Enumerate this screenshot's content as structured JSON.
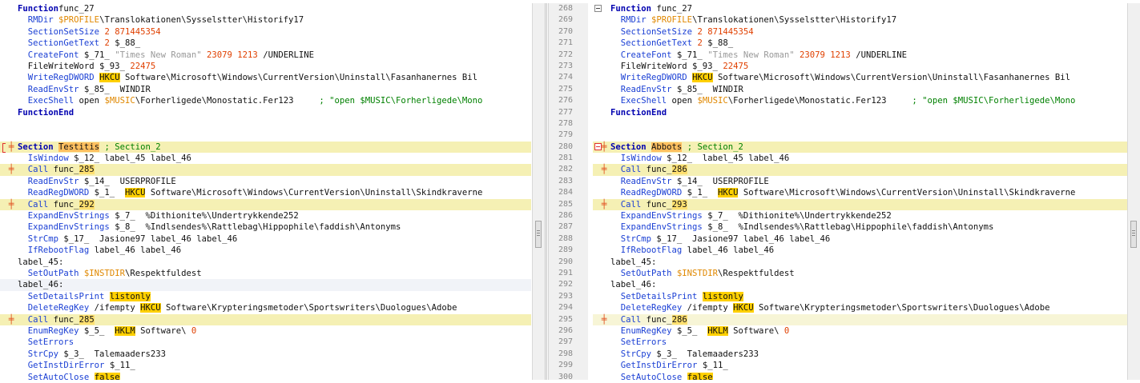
{
  "left_lines": [
    [
      [
        "kw",
        "Function"
      ],
      [
        "",
        "func_27"
      ]
    ],
    [
      [
        "fn",
        "  RMDir"
      ],
      [
        "var",
        " $PROFILE"
      ],
      [
        "",
        "\\Translokationen\\Sysselstter\\Historify17"
      ]
    ],
    [
      [
        "fn",
        "  SectionSetSize"
      ],
      [
        "num",
        " 2 871445354"
      ]
    ],
    [
      [
        "fn",
        "  SectionGetText"
      ],
      [
        "num",
        " 2"
      ],
      [
        "",
        " $_88_"
      ]
    ],
    [
      [
        "fn",
        "  CreateFont"
      ],
      [
        "",
        " $_71_ "
      ],
      [
        "str",
        "\"Times New Roman\""
      ],
      [
        "num",
        " 23079 1213"
      ],
      [
        "",
        " /UNDERLINE"
      ]
    ],
    [
      [
        "",
        "  FileWriteWord $_93_ "
      ],
      [
        "num",
        "22475"
      ]
    ],
    [
      [
        "fn",
        "  WriteRegDWORD"
      ],
      [
        "",
        " "
      ],
      [
        "hi",
        "HKCU"
      ],
      [
        "",
        " Software\\Microsoft\\Windows\\CurrentVersion\\Uninstall\\Fasanhanernes Bil"
      ]
    ],
    [
      [
        "fn",
        "  ReadEnvStr"
      ],
      [
        "",
        " $_85_  WINDIR"
      ]
    ],
    [
      [
        "fn",
        "  ExecShell"
      ],
      [
        "",
        " open "
      ],
      [
        "var",
        "$MUSIC"
      ],
      [
        "",
        "\\Forherligede\\Monostatic.Fer123     "
      ],
      [
        "cmt",
        "; \"open $MUSIC\\Forherligede\\Mono"
      ]
    ],
    [
      [
        "kw",
        "FunctionEnd"
      ]
    ],
    [],
    [],
    [
      [
        "kw",
        "Section"
      ],
      [
        "",
        " "
      ],
      [
        "hd",
        "Testitis"
      ],
      [
        "cmt",
        " ; Section_2"
      ]
    ],
    [
      [
        "fn",
        "  IsWindow"
      ],
      [
        "",
        " $_12_ label_45 label_46"
      ]
    ],
    [
      [
        "fn",
        "  Call"
      ],
      [
        "",
        " func_"
      ],
      [
        "hc",
        "285"
      ]
    ],
    [
      [
        "fn",
        "  ReadEnvStr"
      ],
      [
        "",
        " $_14_  USERPROFILE"
      ]
    ],
    [
      [
        "fn",
        "  ReadRegDWORD"
      ],
      [
        "",
        " $_1_  "
      ],
      [
        "hi",
        "HKCU"
      ],
      [
        "",
        " Software\\Microsoft\\Windows\\CurrentVersion\\Uninstall\\Skindkraverne"
      ]
    ],
    [
      [
        "fn",
        "  Call"
      ],
      [
        "",
        " func_"
      ],
      [
        "hc",
        "292"
      ]
    ],
    [
      [
        "fn",
        "  ExpandEnvStrings"
      ],
      [
        "",
        " $_7_  %Dithionite%\\Undertrykkende252"
      ]
    ],
    [
      [
        "fn",
        "  ExpandEnvStrings"
      ],
      [
        "",
        " $_8_  %Indlsendes%\\Rattlebag\\Hippophile\\faddish\\Antonyms"
      ]
    ],
    [
      [
        "fn",
        "  StrCmp"
      ],
      [
        "",
        " $_17_  Jasione97 label_46 label_46"
      ]
    ],
    [
      [
        "fn",
        "  IfRebootFlag"
      ],
      [
        "",
        " label_46 label_46"
      ]
    ],
    [
      [
        "",
        "label_45:"
      ]
    ],
    [
      [
        "fn",
        "  SetOutPath"
      ],
      [
        "var",
        " $INSTDIR"
      ],
      [
        "",
        "\\Respektfuldest"
      ]
    ],
    [
      [
        "",
        "label_46:"
      ]
    ],
    [
      [
        "fn",
        "  SetDetailsPrint"
      ],
      [
        "",
        " "
      ],
      [
        "hi",
        "listonly"
      ]
    ],
    [
      [
        "fn",
        "  DeleteRegKey"
      ],
      [
        "",
        " /ifempty "
      ],
      [
        "hi",
        "HKCU"
      ],
      [
        "",
        " Software\\Krypteringsmetoder\\Sportswriters\\Duologues\\Adobe"
      ]
    ],
    [
      [
        "fn",
        "  Call"
      ],
      [
        "",
        " func_"
      ],
      [
        "hc",
        "285"
      ]
    ],
    [
      [
        "fn",
        "  EnumRegKey"
      ],
      [
        "",
        " $_5_  "
      ],
      [
        "hi",
        "HKLM"
      ],
      [
        "",
        " Software\\ "
      ],
      [
        "num",
        "0"
      ]
    ],
    [
      [
        "fn",
        "  SetErrors"
      ]
    ],
    [
      [
        "fn",
        "  StrCpy"
      ],
      [
        "",
        " $_3_  Talemaaders233"
      ]
    ],
    [
      [
        "fn",
        "  GetInstDirError"
      ],
      [
        "",
        " $_11_"
      ]
    ],
    [
      [
        "fn",
        "  SetAutoClose"
      ],
      [
        "",
        " "
      ],
      [
        "hi",
        "false"
      ]
    ]
  ],
  "right_lines": [
    [
      [
        "kw",
        "Function"
      ],
      [
        "",
        " func_27"
      ]
    ],
    [
      [
        "fn",
        "  RMDir"
      ],
      [
        "var",
        " $PROFILE"
      ],
      [
        "",
        "\\Translokationen\\Sysselstter\\Historify17"
      ]
    ],
    [
      [
        "fn",
        "  SectionSetSize"
      ],
      [
        "num",
        " 2 871445354"
      ]
    ],
    [
      [
        "fn",
        "  SectionGetText"
      ],
      [
        "num",
        " 2"
      ],
      [
        "",
        " $_88_"
      ]
    ],
    [
      [
        "fn",
        "  CreateFont"
      ],
      [
        "",
        " $_71_ "
      ],
      [
        "str",
        "\"Times New Roman\""
      ],
      [
        "num",
        " 23079 1213"
      ],
      [
        "",
        " /UNDERLINE"
      ]
    ],
    [
      [
        "",
        "  FileWriteWord $_93_ "
      ],
      [
        "num",
        "22475"
      ]
    ],
    [
      [
        "fn",
        "  WriteRegDWORD"
      ],
      [
        "",
        " "
      ],
      [
        "hi",
        "HKCU"
      ],
      [
        "",
        " Software\\Microsoft\\Windows\\CurrentVersion\\Uninstall\\Fasanhanernes Bil"
      ]
    ],
    [
      [
        "fn",
        "  ReadEnvStr"
      ],
      [
        "",
        " $_85_  WINDIR"
      ]
    ],
    [
      [
        "fn",
        "  ExecShell"
      ],
      [
        "",
        " open "
      ],
      [
        "var",
        "$MUSIC"
      ],
      [
        "",
        "\\Forherligede\\Monostatic.Fer123     "
      ],
      [
        "cmt",
        "; \"open $MUSIC\\Forherligede\\Mono"
      ]
    ],
    [
      [
        "kw",
        "FunctionEnd"
      ]
    ],
    [],
    [],
    [
      [
        "kw",
        "Section"
      ],
      [
        "",
        " "
      ],
      [
        "hd",
        "Abbots"
      ],
      [
        "cmt",
        " ; Section_2"
      ]
    ],
    [
      [
        "fn",
        "  IsWindow"
      ],
      [
        "",
        " $_12_  label_45 label_46"
      ]
    ],
    [
      [
        "fn",
        "  Call"
      ],
      [
        "",
        " func_"
      ],
      [
        "hc",
        "286"
      ]
    ],
    [
      [
        "fn",
        "  ReadEnvStr"
      ],
      [
        "",
        " $_14_  USERPROFILE"
      ]
    ],
    [
      [
        "fn",
        "  ReadRegDWORD"
      ],
      [
        "",
        " $_1_  "
      ],
      [
        "hi",
        "HKCU"
      ],
      [
        "",
        " Software\\Microsoft\\Windows\\CurrentVersion\\Uninstall\\Skindkraverne"
      ]
    ],
    [
      [
        "fn",
        "  Call"
      ],
      [
        "",
        " func_"
      ],
      [
        "hc",
        "293"
      ]
    ],
    [
      [
        "fn",
        "  ExpandEnvStrings"
      ],
      [
        "",
        " $_7_  %Dithionite%\\Undertrykkende252"
      ]
    ],
    [
      [
        "fn",
        "  ExpandEnvStrings"
      ],
      [
        "",
        " $_8_  %Indlsendes%\\Rattlebag\\Hippophile\\faddish\\Antonyms"
      ]
    ],
    [
      [
        "fn",
        "  StrCmp"
      ],
      [
        "",
        " $_17_  Jasione97 label_46 label_46"
      ]
    ],
    [
      [
        "fn",
        "  IfRebootFlag"
      ],
      [
        "",
        " label_46 label_46"
      ]
    ],
    [
      [
        "",
        "label_45:"
      ]
    ],
    [
      [
        "fn",
        "  SetOutPath"
      ],
      [
        "var",
        " $INSTDIR"
      ],
      [
        "",
        "\\Respektfuldest"
      ]
    ],
    [
      [
        "",
        "label_46:"
      ]
    ],
    [
      [
        "fn",
        "  SetDetailsPrint"
      ],
      [
        "",
        " "
      ],
      [
        "hi",
        "listonly"
      ]
    ],
    [
      [
        "fn",
        "  DeleteRegKey"
      ],
      [
        "",
        " /ifempty "
      ],
      [
        "hi",
        "HKCU"
      ],
      [
        "",
        " Software\\Krypteringsmetoder\\Sportswriters\\Duologues\\Adobe"
      ]
    ],
    [
      [
        "fn",
        "  Call"
      ],
      [
        "",
        " func_"
      ],
      [
        "hc",
        "286"
      ]
    ],
    [
      [
        "fn",
        "  EnumRegKey"
      ],
      [
        "",
        " $_5_  "
      ],
      [
        "hi",
        "HKLM"
      ],
      [
        "",
        " Software\\ "
      ],
      [
        "num",
        "0"
      ]
    ],
    [
      [
        "fn",
        "  SetErrors"
      ]
    ],
    [
      [
        "fn",
        "  StrCpy"
      ],
      [
        "",
        " $_3_  Talemaaders233"
      ]
    ],
    [
      [
        "fn",
        "  GetInstDirError"
      ],
      [
        "",
        " $_11_"
      ]
    ],
    [
      [
        "fn",
        "  SetAutoClose"
      ],
      [
        "",
        " "
      ],
      [
        "hi",
        "false"
      ]
    ]
  ],
  "line_numbers": [
    "268",
    "269",
    "270",
    "271",
    "272",
    "273",
    "274",
    "275",
    "276",
    "277",
    "278",
    "279",
    "280",
    "281",
    "282",
    "283",
    "284",
    "285",
    "286",
    "287",
    "288",
    "289",
    "290",
    "291",
    "292",
    "293",
    "294",
    "295",
    "296",
    "297",
    "298",
    "299",
    "300"
  ],
  "diff_rows": [
    12,
    14,
    17,
    27
  ],
  "colors": {
    "changed": "#f5f0b4",
    "highlight": "#ffd000",
    "marker": "#e05020",
    "fold_line": "#ff3b3b"
  }
}
